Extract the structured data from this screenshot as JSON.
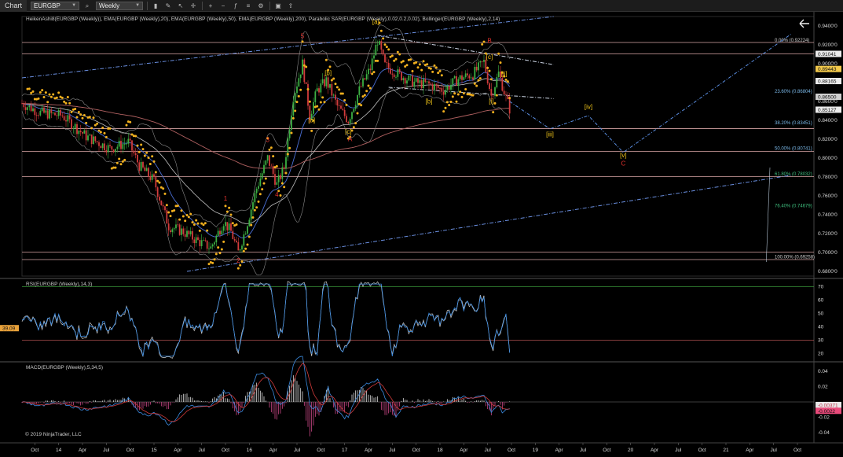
{
  "toolbar": {
    "title": "Chart",
    "instrument": "EURGBP",
    "period": "Weekly"
  },
  "indicators": {
    "price_panel_label": "HeikenAshi8(EURGBP (Weekly)), EMA(EURGBP (Weekly),20), EMA(EURGBP (Weekly),50), EMA(EURGBP (Weekly),200), Parabolic SAR(EURGBP (Weekly),0.02,0.2,0.02), Bollinger(EURGBP (Weekly),2,14)",
    "rsi_label": "RSI(EURGBP (Weekly),14,3)",
    "macd_label": "MACD(EURGBP (Weekly),5,34,5)"
  },
  "copyright": "© 2019 NinjaTrader, LLC",
  "colors": {
    "bull": "#3cb043",
    "bear": "#d23c3c",
    "sar": "#f2b01e",
    "ema20": "#4a6fd6",
    "ema50": "#bfbfbf",
    "ema200": "#b06060",
    "fib": "#7ab8e8",
    "wave_red": "#e8322e",
    "wave_yellow": "#f0c419",
    "trend": "#6a8fe0"
  },
  "price_axis": {
    "ticks": [
      "0.9400'0",
      "0.9200'0",
      "0.9000'0",
      "0.8800'0",
      "0.8600'0",
      "0.8400'0",
      "0.8200'0",
      "0.8000'0",
      "0.7800'0",
      "0.7600'0",
      "0.7400'0",
      "0.7200'0",
      "0.7000'0",
      "0.6800'0"
    ],
    "flags": [
      {
        "text": "0.91041",
        "color": "#111",
        "bg": "#ececec",
        "value": 0.91041
      },
      {
        "text": "0.89443",
        "color": "#111",
        "bg": "#f2c94c",
        "value": 0.89443
      },
      {
        "text": "0.88165",
        "color": "#111",
        "bg": "#ececec",
        "value": 0.88165
      },
      {
        "text": "0.86500",
        "color": "#111",
        "bg": "#cfcfcf",
        "value": 0.865
      },
      {
        "text": "0.85127",
        "color": "#111",
        "bg": "#ececec",
        "value": 0.85127
      }
    ]
  },
  "fib_levels": [
    {
      "label": "0.00% (0.92224)",
      "value": 0.92224,
      "color": "#cfcfcf"
    },
    {
      "label": "23.60% (0.86804)",
      "value": 0.86804,
      "color": "#7ab8e8"
    },
    {
      "label": "38.20% (0.83451)",
      "value": 0.83451,
      "color": "#7ab8e8"
    },
    {
      "label": "50.00% (0.80741)",
      "value": 0.80741,
      "color": "#7ab8e8"
    },
    {
      "label": "61.80% (0.78032)",
      "value": 0.78032,
      "color": "#3fbf7f"
    },
    {
      "label": "76.40% (0.74679)",
      "value": 0.74679,
      "color": "#3fbf7f"
    },
    {
      "label": "100.00% (0.69258)",
      "value": 0.69258,
      "color": "#cfcfcf"
    }
  ],
  "horizontal_levels": [
    0.9225,
    0.9104,
    0.8312,
    0.807,
    0.7805,
    0.7005,
    0.6925
  ],
  "wave_labels": [
    {
      "text": "1",
      "color": "#e8322e",
      "week": 111,
      "price": 0.755
    },
    {
      "text": "2",
      "color": "#e8322e",
      "week": 118,
      "price": 0.689
    },
    {
      "text": "3",
      "color": "#e8322e",
      "week": 134,
      "price": 0.817
    },
    {
      "text": "4",
      "color": "#e8322e",
      "week": 139,
      "price": 0.759
    },
    {
      "text": "5",
      "color": "#e8322e",
      "week": 153,
      "price": 0.927
    },
    {
      "text": "[a]",
      "color": "#f0c419",
      "week": 158,
      "price": 0.838
    },
    {
      "text": "[b]",
      "color": "#f0c419",
      "week": 167,
      "price": 0.888
    },
    {
      "text": "[c]",
      "color": "#f0c419",
      "week": 178,
      "price": 0.826
    },
    {
      "text": "A",
      "color": "#e8322e",
      "week": 179,
      "price": 0.818
    },
    {
      "text": "[a]",
      "color": "#f0c419",
      "week": 193,
      "price": 0.942
    },
    {
      "text": "[b]",
      "color": "#f0c419",
      "week": 222,
      "price": 0.858
    },
    {
      "text": "B",
      "color": "#e8322e",
      "week": 255,
      "price": 0.922
    },
    {
      "text": "[c]",
      "color": "#f0c419",
      "week": 255,
      "price": 0.905
    },
    {
      "text": "[ii]",
      "color": "#f0c419",
      "week": 263,
      "price": 0.887
    },
    {
      "text": "[i]",
      "color": "#f0c419",
      "week": 256,
      "price": 0.858
    },
    {
      "text": "[iii]",
      "color": "#f0c419",
      "week": 288,
      "price": 0.823
    },
    {
      "text": "[iv]",
      "color": "#f0c419",
      "week": 309,
      "price": 0.852
    },
    {
      "text": "[v]",
      "color": "#f0c419",
      "week": 328,
      "price": 0.801
    },
    {
      "text": "C",
      "color": "#e8322e",
      "week": 328,
      "price": 0.792
    }
  ],
  "x_axis": {
    "labels": [
      {
        "text": "Oct",
        "week": 7
      },
      {
        "text": "14",
        "week": 20
      },
      {
        "text": "Apr",
        "week": 33
      },
      {
        "text": "Jul",
        "week": 46
      },
      {
        "text": "Oct",
        "week": 59
      },
      {
        "text": "15",
        "week": 72
      },
      {
        "text": "Apr",
        "week": 85
      },
      {
        "text": "Jul",
        "week": 98
      },
      {
        "text": "Oct",
        "week": 111
      },
      {
        "text": "16",
        "week": 124
      },
      {
        "text": "Apr",
        "week": 137
      },
      {
        "text": "Jul",
        "week": 150
      },
      {
        "text": "Oct",
        "week": 163
      },
      {
        "text": "17",
        "week": 176
      },
      {
        "text": "Apr",
        "week": 189
      },
      {
        "text": "Jul",
        "week": 202
      },
      {
        "text": "Oct",
        "week": 215
      },
      {
        "text": "18",
        "week": 228
      },
      {
        "text": "Apr",
        "week": 241
      },
      {
        "text": "Jul",
        "week": 254
      },
      {
        "text": "Oct",
        "week": 267
      },
      {
        "text": "19",
        "week": 280
      },
      {
        "text": "Apr",
        "week": 293
      },
      {
        "text": "Jul",
        "week": 306
      },
      {
        "text": "Oct",
        "week": 319
      },
      {
        "text": "20",
        "week": 332
      },
      {
        "text": "Apr",
        "week": 345
      },
      {
        "text": "Jul",
        "week": 358
      },
      {
        "text": "Oct",
        "week": 371
      },
      {
        "text": "21",
        "week": 384
      },
      {
        "text": "Apr",
        "week": 397
      },
      {
        "text": "Jul",
        "week": 410
      },
      {
        "text": "Oct",
        "week": 423
      }
    ]
  },
  "rsi": {
    "ticks": [
      "70",
      "60",
      "50",
      "40",
      "30",
      "20"
    ],
    "current": "39.09"
  },
  "macd": {
    "ticks": [
      "0.04",
      "0.02",
      "-0.02",
      "-0.04"
    ],
    "current": "-0.00371",
    "current2": "-0.0022"
  },
  "chart_data": {
    "type": "candlestick",
    "instrument": "EURGBP",
    "timeframe": "Weekly",
    "price_range": [
      0.675,
      0.95
    ],
    "price_path": [
      {
        "week": 0,
        "price": 0.858
      },
      {
        "week": 10,
        "price": 0.848
      },
      {
        "week": 22,
        "price": 0.845
      },
      {
        "week": 35,
        "price": 0.823
      },
      {
        "week": 48,
        "price": 0.81
      },
      {
        "week": 58,
        "price": 0.817
      },
      {
        "week": 64,
        "price": 0.792
      },
      {
        "week": 72,
        "price": 0.776
      },
      {
        "week": 80,
        "price": 0.728
      },
      {
        "week": 88,
        "price": 0.722
      },
      {
        "week": 96,
        "price": 0.712
      },
      {
        "week": 103,
        "price": 0.705
      },
      {
        "week": 110,
        "price": 0.733
      },
      {
        "week": 114,
        "price": 0.722
      },
      {
        "week": 118,
        "price": 0.7
      },
      {
        "week": 122,
        "price": 0.725
      },
      {
        "week": 128,
        "price": 0.768
      },
      {
        "week": 134,
        "price": 0.8
      },
      {
        "week": 139,
        "price": 0.772
      },
      {
        "week": 143,
        "price": 0.79
      },
      {
        "week": 148,
        "price": 0.865
      },
      {
        "week": 153,
        "price": 0.9
      },
      {
        "week": 157,
        "price": 0.845
      },
      {
        "week": 161,
        "price": 0.872
      },
      {
        "week": 166,
        "price": 0.882
      },
      {
        "week": 172,
        "price": 0.855
      },
      {
        "week": 178,
        "price": 0.84
      },
      {
        "week": 184,
        "price": 0.872
      },
      {
        "week": 190,
        "price": 0.895
      },
      {
        "week": 194,
        "price": 0.925
      },
      {
        "week": 198,
        "price": 0.898
      },
      {
        "week": 206,
        "price": 0.888
      },
      {
        "week": 214,
        "price": 0.88
      },
      {
        "week": 222,
        "price": 0.878
      },
      {
        "week": 230,
        "price": 0.872
      },
      {
        "week": 238,
        "price": 0.884
      },
      {
        "week": 246,
        "price": 0.889
      },
      {
        "week": 252,
        "price": 0.902
      },
      {
        "week": 256,
        "price": 0.866
      },
      {
        "week": 260,
        "price": 0.89
      },
      {
        "week": 264,
        "price": 0.864
      },
      {
        "week": 266,
        "price": 0.852
      }
    ],
    "projection": [
      {
        "week": 266,
        "price": 0.86
      },
      {
        "week": 288,
        "price": 0.831
      },
      {
        "week": 309,
        "price": 0.845
      },
      {
        "week": 328,
        "price": 0.806
      },
      {
        "week": 420,
        "price": 0.932
      }
    ],
    "trendlines": [
      {
        "name": "upper-channel",
        "from": {
          "week": 0,
          "price": 0.885
        },
        "to": {
          "week": 290,
          "price": 0.95
        }
      },
      {
        "name": "lower-channel",
        "from": {
          "week": 90,
          "price": 0.68
        },
        "to": {
          "week": 420,
          "price": 0.782
        }
      },
      {
        "name": "upper-wedge",
        "from": {
          "week": 194,
          "price": 0.93
        },
        "to": {
          "week": 290,
          "price": 0.899
        }
      },
      {
        "name": "lower-wedge",
        "from": {
          "week": 200,
          "price": 0.875
        },
        "to": {
          "week": 290,
          "price": 0.863
        }
      }
    ]
  }
}
